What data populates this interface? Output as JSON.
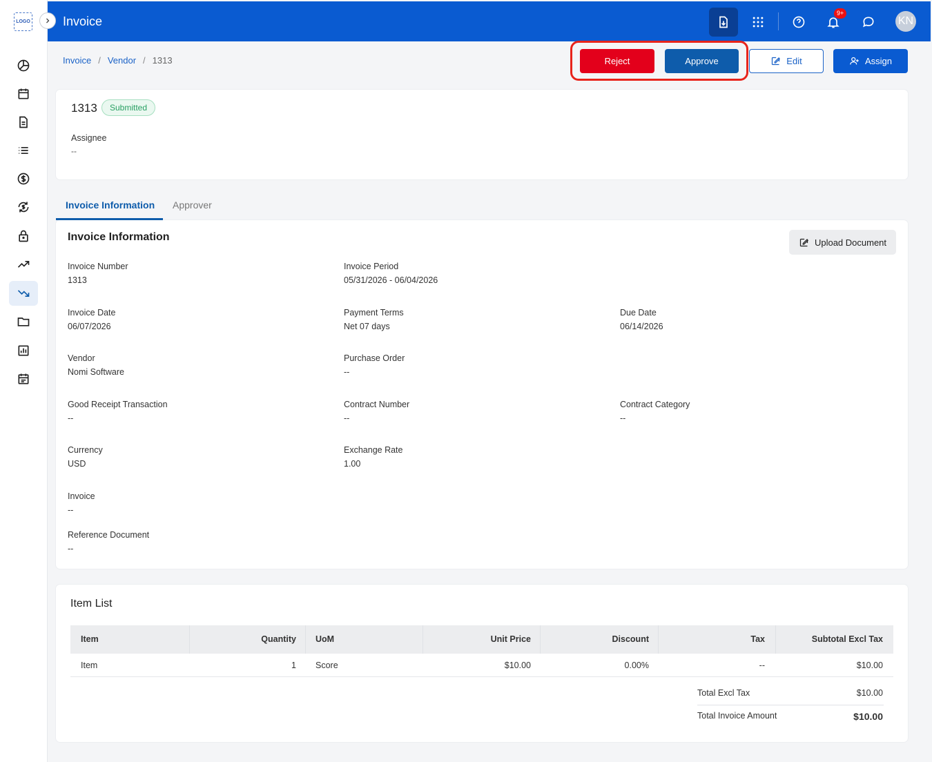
{
  "app": {
    "logo_text": "LOGO",
    "title": "Invoice"
  },
  "header": {
    "notification_badge": "9+",
    "avatar_initials": "KN"
  },
  "sidebar": {
    "icons": [
      "dashboard-icon",
      "calendar-icon",
      "document-icon",
      "list-icon",
      "dollar-icon",
      "exchange-icon",
      "lock-icon",
      "trend-up-icon",
      "trend-down-icon",
      "folder-icon",
      "report-icon",
      "schedule-icon"
    ]
  },
  "breadcrumb": {
    "item1": "Invoice",
    "item2": "Vendor",
    "current": "1313"
  },
  "actions": {
    "reject": "Reject",
    "approve": "Approve",
    "edit": "Edit",
    "assign": "Assign"
  },
  "summary": {
    "number": "1313",
    "status": "Submitted",
    "assignee_label": "Assignee",
    "assignee_value": "--"
  },
  "tabs": {
    "active": "Invoice Information",
    "other": "Approver"
  },
  "info": {
    "title": "Invoice Information",
    "upload_label": "Upload Document",
    "fields": {
      "invoice_number": {
        "label": "Invoice Number",
        "value": "1313"
      },
      "invoice_period": {
        "label": "Invoice Period",
        "value": "05/31/2026 - 06/04/2026"
      },
      "invoice_date": {
        "label": "Invoice Date",
        "value": "06/07/2026"
      },
      "payment_terms": {
        "label": "Payment Terms",
        "value": "Net 07 days"
      },
      "due_date": {
        "label": "Due Date",
        "value": "06/14/2026"
      },
      "vendor": {
        "label": "Vendor",
        "value": "Nomi Software"
      },
      "purchase_order": {
        "label": "Purchase Order",
        "value": "--"
      },
      "good_receipt": {
        "label": "Good Receipt Transaction",
        "value": "--"
      },
      "contract_number": {
        "label": "Contract Number",
        "value": "--"
      },
      "contract_category": {
        "label": "Contract Category",
        "value": "--"
      },
      "currency": {
        "label": "Currency",
        "value": "USD"
      },
      "exchange_rate": {
        "label": "Exchange Rate",
        "value": "1.00"
      },
      "invoice": {
        "label": "Invoice",
        "value": "--"
      },
      "reference_document": {
        "label": "Reference Document",
        "value": "--"
      }
    }
  },
  "items": {
    "title": "Item List",
    "headers": {
      "item": "Item",
      "quantity": "Quantity",
      "uom": "UoM",
      "unit_price": "Unit Price",
      "discount": "Discount",
      "tax": "Tax",
      "subtotal": "Subtotal Excl Tax"
    },
    "rows": [
      {
        "item": "Item",
        "quantity": "1",
        "uom": "Score",
        "unit_price": "$10.00",
        "discount": "0.00%",
        "tax": "--",
        "subtotal": "$10.00"
      }
    ],
    "total_excl_tax_label": "Total Excl Tax",
    "total_excl_tax_value": "$10.00",
    "total_invoice_label": "Total Invoice Amount",
    "total_invoice_value": "$10.00"
  }
}
